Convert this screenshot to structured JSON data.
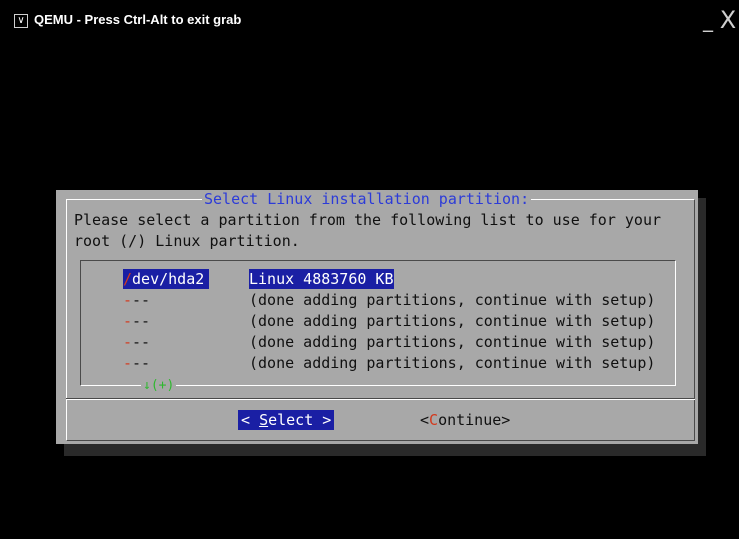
{
  "window": {
    "title": "QEMU - Press Ctrl-Alt to exit grab",
    "menu_glyph": "∨",
    "minimize_glyph": "_",
    "close_glyph": "X"
  },
  "dialog": {
    "title": "Select Linux installation partition:",
    "prompt_line1": "Please select a partition from the following list to use for your",
    "prompt_line2": "root (/) Linux partition.",
    "scroll_indicator": "↓(+)",
    "items": [
      {
        "tag_first": "/",
        "tag_rest": "dev/hda2",
        "text": "Linux 4883760 KB",
        "selected": true
      },
      {
        "tag_first": "-",
        "tag_rest": "--",
        "text": "(done adding partitions, continue with setup)",
        "selected": false
      },
      {
        "tag_first": "-",
        "tag_rest": "--",
        "text": "(done adding partitions, continue with setup)",
        "selected": false
      },
      {
        "tag_first": "-",
        "tag_rest": "--",
        "text": "(done adding partitions, continue with setup)",
        "selected": false
      },
      {
        "tag_first": "-",
        "tag_rest": "--",
        "text": "(done adding partitions, continue with setup)",
        "selected": false
      }
    ],
    "buttons": {
      "select": {
        "open": "< ",
        "hotkey": "S",
        "rest": "elect",
        "close": " >"
      },
      "continue": {
        "open": "<",
        "hotkey": "C",
        "rest": "ontinue",
        "close": ">"
      }
    }
  },
  "colors": {
    "dialog_bg": "#a8a8a8",
    "title_text": "#2c3bd8",
    "highlight_bg": "#1a1fa4",
    "hotkey": "#d33a1e",
    "scroll_indicator": "#2fb82f"
  }
}
